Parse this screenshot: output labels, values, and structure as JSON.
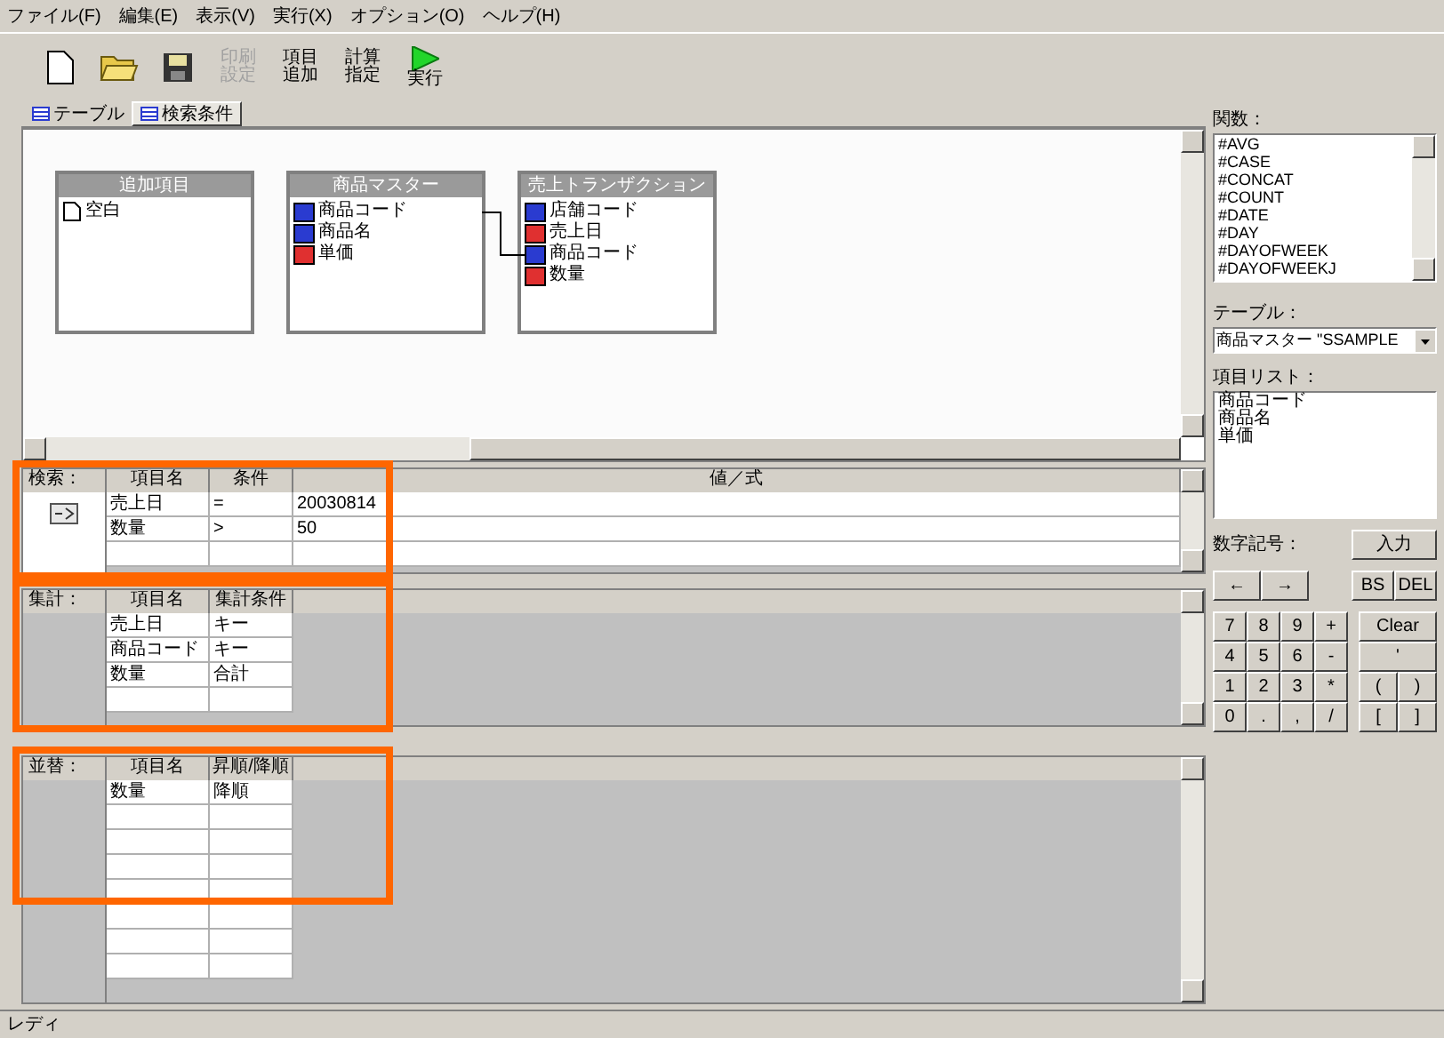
{
  "menu": [
    "ファイル(F)",
    "編集(E)",
    "表示(V)",
    "実行(X)",
    "オプション(O)",
    "ヘルプ(H)"
  ],
  "toolbar": [
    {
      "kind": "new"
    },
    {
      "kind": "open"
    },
    {
      "kind": "save"
    },
    {
      "kind": "text",
      "lines": [
        "印刷",
        "設定"
      ],
      "disabled": true
    },
    {
      "kind": "text",
      "lines": [
        "項目",
        "追加"
      ],
      "disabled": false
    },
    {
      "kind": "text",
      "lines": [
        "計算",
        "指定"
      ],
      "disabled": false
    },
    {
      "kind": "run",
      "lines": [
        "実行"
      ],
      "disabled": false
    }
  ],
  "tabs": [
    {
      "label": "テーブル",
      "selected": false
    },
    {
      "label": "検索条件",
      "selected": true
    }
  ],
  "tables": [
    {
      "title": "追加項目",
      "fields": [
        {
          "name": "空白",
          "kind": "blank"
        }
      ]
    },
    {
      "title": "商品マスター",
      "fields": [
        {
          "name": "商品コード",
          "kind": "text"
        },
        {
          "name": "商品名",
          "kind": "text"
        },
        {
          "name": "単価",
          "kind": "number"
        }
      ]
    },
    {
      "title": "売上トランザクション",
      "fields": [
        {
          "name": "店舗コード",
          "kind": "text"
        },
        {
          "name": "売上日",
          "kind": "number"
        },
        {
          "name": "商品コード",
          "kind": "text"
        },
        {
          "name": "数量",
          "kind": "number"
        }
      ]
    }
  ],
  "sections": [
    {
      "kind": "search",
      "label": "検索：",
      "columns": [
        "項目名",
        "条件",
        "値／式"
      ],
      "rows": [
        [
          "売上日",
          "=",
          "20030814"
        ],
        [
          "数量",
          ">",
          "50"
        ]
      ]
    },
    {
      "kind": "aggregate",
      "label": "集計：",
      "columns": [
        "項目名",
        "集計条件"
      ],
      "rows": [
        [
          "売上日",
          "キー"
        ],
        [
          "商品コード",
          "キー"
        ],
        [
          "数量",
          "合計"
        ]
      ]
    },
    {
      "kind": "sort",
      "label": "並替：",
      "columns": [
        "項目名",
        "昇順/降順"
      ],
      "rows": [
        [
          "数量",
          "降順"
        ]
      ]
    }
  ],
  "status_bar": "レディ",
  "functions": {
    "label": "関数：",
    "items": [
      "#AVG",
      "#CASE",
      "#CONCAT",
      "#COUNT",
      "#DATE",
      "#DAY",
      "#DAYOFWEEK",
      "#DAYOFWEEKJ"
    ]
  },
  "table_select": {
    "label": "テーブル：",
    "value": "商品マスター \"SSAMPLE"
  },
  "field_list": {
    "label": "項目リスト：",
    "items": [
      "商品コード",
      "商品名",
      "単価"
    ]
  },
  "symbols": {
    "label": "数字記号：",
    "enter": "入力",
    "arrows": [
      "←",
      "→"
    ],
    "edit": [
      "BS",
      "DEL"
    ],
    "keypad": [
      "7",
      "8",
      "9",
      "+",
      "4",
      "5",
      "6",
      "-",
      "1",
      "2",
      "3",
      "*",
      "0",
      ".",
      ",",
      "/"
    ],
    "clear": "Clear",
    "quote": "'",
    "brackets": [
      "(",
      ")",
      "[",
      "]"
    ]
  }
}
